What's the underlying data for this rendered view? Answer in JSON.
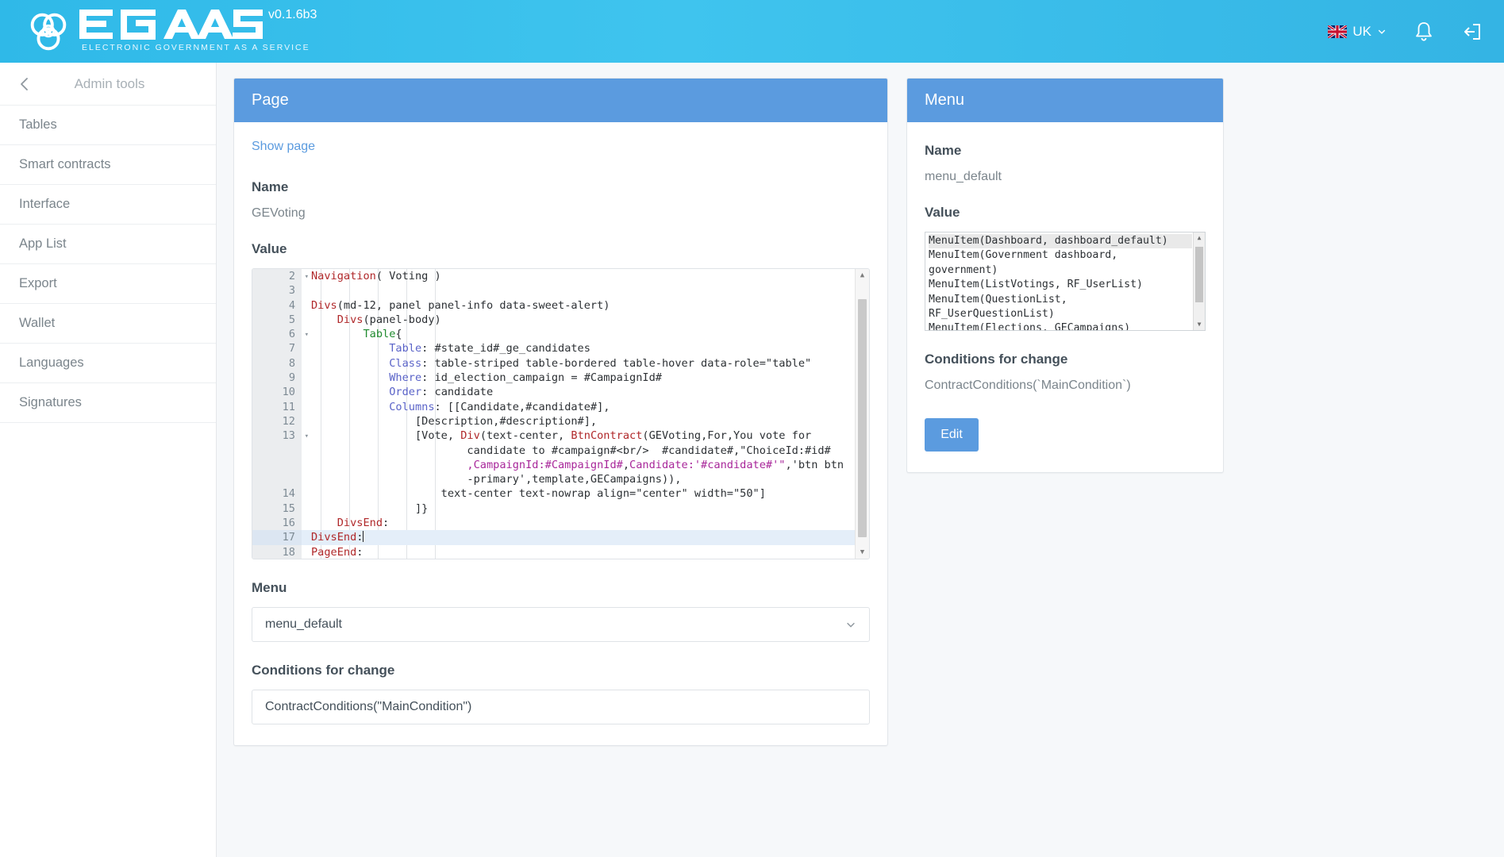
{
  "topbar": {
    "brand_name": "EGAAS",
    "brand_tagline": "ELECTRONIC GOVERNMENT AS A SERVICE",
    "version": "v0.1.6b3",
    "language": "UK",
    "icons": {
      "flag": "uk-flag-icon",
      "chevron": "chevron-down-icon",
      "bell": "bell-icon",
      "logout": "logout-icon"
    }
  },
  "sidebar": {
    "title": "Admin tools",
    "back_icon": "chevron-left-icon",
    "items": [
      {
        "label": "Tables"
      },
      {
        "label": "Smart contracts"
      },
      {
        "label": "Interface"
      },
      {
        "label": "App List"
      },
      {
        "label": "Export"
      },
      {
        "label": "Wallet"
      },
      {
        "label": "Languages"
      },
      {
        "label": "Signatures"
      }
    ]
  },
  "page_panel": {
    "header": "Page",
    "show_page_link": "Show page",
    "name_label": "Name",
    "name_value": "GEVoting",
    "value_label": "Value",
    "menu_label": "Menu",
    "menu_value": "menu_default",
    "conditions_label": "Conditions for change",
    "conditions_value": "ContractConditions(\"MainCondition\")"
  },
  "editor": {
    "highlighted_line": 17,
    "lines": [
      {
        "num": "2",
        "fold": true,
        "text": "Navigation( Voting )"
      },
      {
        "num": "3",
        "fold": false,
        "text": ""
      },
      {
        "num": "4",
        "fold": false,
        "text": "Divs(md-12, panel panel-info data-sweet-alert)"
      },
      {
        "num": "5",
        "fold": false,
        "text": "    Divs(panel-body)"
      },
      {
        "num": "6",
        "fold": true,
        "text": "        Table{"
      },
      {
        "num": "7",
        "fold": false,
        "text": "            Table: #state_id#_ge_candidates"
      },
      {
        "num": "8",
        "fold": false,
        "text": "            Class: table-striped table-bordered table-hover data-role=\"table\""
      },
      {
        "num": "9",
        "fold": false,
        "text": "            Where: id_election_campaign = #CampaignId#"
      },
      {
        "num": "10",
        "fold": false,
        "text": "            Order: candidate"
      },
      {
        "num": "11",
        "fold": false,
        "text": "            Columns: [[Candidate,#candidate#],"
      },
      {
        "num": "12",
        "fold": false,
        "text": "                [Description,#description#],"
      },
      {
        "num": "13",
        "fold": true,
        "text": "                [Vote, Div(text-center, BtnContract(GEVoting,For,You vote for"
      },
      {
        "num": "",
        "fold": false,
        "text": "                        candidate to #campaign#<br/>  #candidate#,\"ChoiceId:#id#"
      },
      {
        "num": "",
        "fold": false,
        "text": "                        ,CampaignId:#CampaignId#,Candidate:'#candidate#'\",'btn btn"
      },
      {
        "num": "",
        "fold": false,
        "text": "                        -primary',template,GECampaigns)),"
      },
      {
        "num": "14",
        "fold": false,
        "text": "                    text-center text-nowrap align=\"center\" width=\"50\"]"
      },
      {
        "num": "15",
        "fold": false,
        "text": "                ]}"
      },
      {
        "num": "16",
        "fold": false,
        "text": "    DivsEnd:"
      },
      {
        "num": "17",
        "fold": false,
        "text": "DivsEnd:"
      },
      {
        "num": "18",
        "fold": false,
        "text": "PageEnd:"
      }
    ]
  },
  "menu_panel": {
    "header": "Menu",
    "name_label": "Name",
    "name_value": "menu_default",
    "value_label": "Value",
    "value_lines": [
      "MenuItem(Dashboard, dashboard_default)",
      " MenuItem(Government dashboard,",
      " government)",
      "MenuItem(ListVotings, RF_UserList)",
      "MenuItem(QuestionList,",
      "RF_UserQuestionList)",
      "MenuItem(Elections, GECampaigns)"
    ],
    "conditions_label": "Conditions for change",
    "conditions_value": "ContractConditions(`MainCondition`)",
    "edit_button": "Edit"
  },
  "colors": {
    "topbar": "#34b4e4",
    "panel_header": "#5b9bdf",
    "link": "#5b9bdf",
    "highlight_row": "#e4eef9"
  }
}
